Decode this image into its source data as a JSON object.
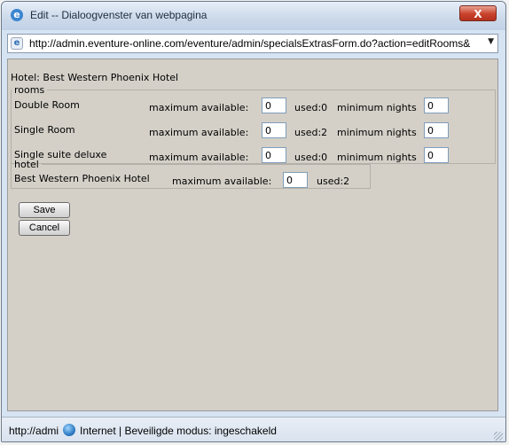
{
  "window": {
    "title": "Edit -- Dialoogvenster van webpagina",
    "close_symbol": "X",
    "title_icon": "ie-icon"
  },
  "address": {
    "url": "http://admin.eventure-online.com/eventure/admin/specialsExtrasForm.do?action=editRooms&",
    "dropdown_symbol": "▼",
    "page_icon": "page-icon"
  },
  "form": {
    "hotel_header": "Hotel:  Best Western Phoenix Hotel",
    "rooms_legend": "rooms",
    "rooms": [
      {
        "name": "Double Room",
        "max_label": "maximum available:",
        "max_value": "0",
        "used": "used:0",
        "min_label": "minimum nights",
        "min_value": "0"
      },
      {
        "name": "Single Room",
        "max_label": "maximum available:",
        "max_value": "0",
        "used": "used:2",
        "min_label": "minimum nights",
        "min_value": "0"
      },
      {
        "name": "Single suite deluxe",
        "max_label": "maximum available:",
        "max_value": "0",
        "used": "used:0",
        "min_label": "minimum nights",
        "min_value": "0"
      }
    ],
    "hotel_legend": "hotel",
    "hotel": {
      "name": "Best Western Phoenix Hotel",
      "max_label": "maximum available:",
      "max_value": "0",
      "used": "used:2"
    },
    "save_label": "Save",
    "cancel_label": "Cancel"
  },
  "status": {
    "url": "http://admi",
    "zone": "Internet | Beveiligde modus: ingeschakeld",
    "zone_icon": "globe-icon"
  },
  "colors": {
    "content_bg": "#d4d0c8",
    "titlebar": "#cbd9ea",
    "close_button": "#c9412b"
  }
}
